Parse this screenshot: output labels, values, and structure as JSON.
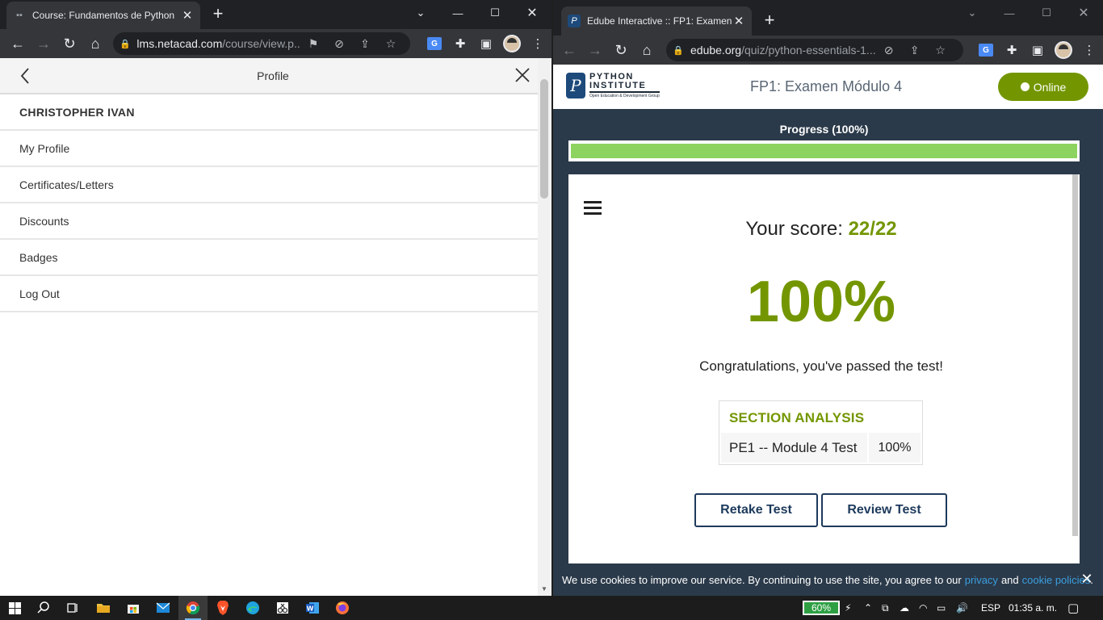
{
  "left_window": {
    "tab_title": "Course: Fundamentos de Python",
    "address_host": "lms.netacad.com",
    "address_path": "/course/view.p...",
    "profile_title": "Profile",
    "menu": [
      {
        "label": "CHRISTOPHER IVAN"
      },
      {
        "label": "My Profile"
      },
      {
        "label": "Certificates/Letters"
      },
      {
        "label": "Discounts"
      },
      {
        "label": "Badges"
      },
      {
        "label": "Log Out"
      }
    ]
  },
  "right_window": {
    "tab_title": "Edube Interactive :: FP1: Examen M",
    "address_host": "edube.org",
    "address_path": "/quiz/python-essentials-1...",
    "logo_line1": "PYTHON",
    "logo_line2": "INSTITUTE",
    "logo_tagline": "Open Education & Development Group",
    "page_title": "FP1: Examen Módulo 4",
    "online_label": "Online",
    "progress_label": "Progress (100%)",
    "progress_fraction": 1.0,
    "score_label": "Your score:",
    "score_value": "22/22",
    "percent": "100%",
    "congrats": "Congratulations, you've passed the test!",
    "section_title": "SECTION ANALYSIS",
    "section_row": {
      "name": "PE1 -- Module 4 Test",
      "value": "100%"
    },
    "retake_label": "Retake Test",
    "review_label": "Review Test",
    "cookie": {
      "text_before": "We use cookies to improve our service. By continuing to use the site, you agree to our",
      "privacy": "privacy",
      "and": "and",
      "cookie_policies": "cookie policies",
      "period": "."
    }
  },
  "taskbar": {
    "battery": "60%",
    "language": "ESP",
    "clock": "01:35 a. m."
  },
  "colors": {
    "accent_green": "#739600",
    "progress_green": "#8dd35f",
    "edube_navy": "#2b3a4a",
    "button_blue": "#1d3a5c",
    "link_blue": "#3a9fe0"
  }
}
